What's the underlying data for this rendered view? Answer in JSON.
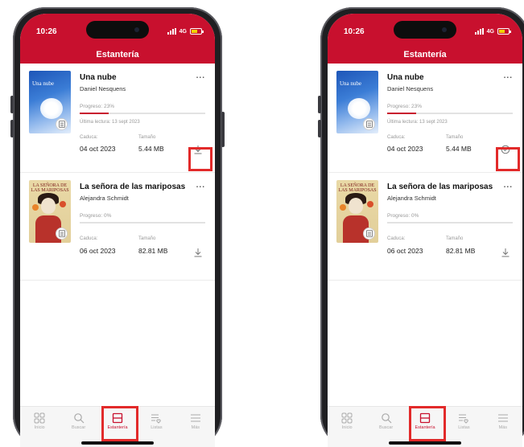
{
  "colors": {
    "accent": "#c8102e",
    "highlight": "#e22a2a"
  },
  "screens": [
    {
      "status": {
        "time": "10:26",
        "network": "4G",
        "battery": ""
      },
      "header": {
        "title": "Estantería"
      },
      "books": [
        {
          "title": "Una nube",
          "cover_title": "Una nube",
          "author": "Daniel Nesquens",
          "progress_label": "Progreso: 23%",
          "progress": 0.23,
          "last_read": "Última lectura: 13 sept 2023",
          "expires_label": "Caduca:",
          "expires": "04 oct 2023",
          "size_label": "Tamaño",
          "size": "5.44 MB",
          "action_icon": "download-icon",
          "more": "..."
        },
        {
          "title": "La señora de las mariposas",
          "cover_title": "LA SEÑORA DE LAS MARIPOSAS",
          "author": "Alejandra Schmidt",
          "progress_label": "Progreso: 0%",
          "progress": 0,
          "expires_label": "Caduca:",
          "expires": "06 oct 2023",
          "size_label": "Tamaño",
          "size": "82.81 MB",
          "action_icon": "download-icon",
          "more": "..."
        }
      ],
      "tabs": [
        {
          "label": "Inicio",
          "icon": "grid-icon"
        },
        {
          "label": "Buscar",
          "icon": "search-icon"
        },
        {
          "label": "Estantería",
          "icon": "shelf-icon",
          "active": true
        },
        {
          "label": "Listas",
          "icon": "list-heart-icon"
        },
        {
          "label": "Más",
          "icon": "menu-icon"
        }
      ]
    },
    {
      "status": {
        "time": "10:26",
        "network": "4G",
        "battery": ""
      },
      "header": {
        "title": "Estantería"
      },
      "books": [
        {
          "title": "Una nube",
          "cover_title": "Una nube",
          "author": "Daniel Nesquens",
          "progress_label": "Progreso: 23%",
          "progress": 0.23,
          "last_read": "Última lectura: 13 sept 2023",
          "expires_label": "Caduca:",
          "expires": "04 oct 2023",
          "size_label": "Tamaño",
          "size": "5.44 MB",
          "action_icon": "downloaded-check-icon",
          "more": "..."
        },
        {
          "title": "La señora de las mariposas",
          "cover_title": "LA SEÑORA DE LAS MARIPOSAS",
          "author": "Alejandra Schmidt",
          "progress_label": "Progreso: 0%",
          "progress": 0,
          "expires_label": "Caduca:",
          "expires": "06 oct 2023",
          "size_label": "Tamaño",
          "size": "82.81 MB",
          "action_icon": "download-icon",
          "more": "..."
        }
      ],
      "tabs": [
        {
          "label": "Inicio",
          "icon": "grid-icon"
        },
        {
          "label": "Buscar",
          "icon": "search-icon"
        },
        {
          "label": "Estantería",
          "icon": "shelf-icon",
          "active": true
        },
        {
          "label": "Listas",
          "icon": "list-heart-icon"
        },
        {
          "label": "Más",
          "icon": "menu-icon"
        }
      ]
    }
  ]
}
